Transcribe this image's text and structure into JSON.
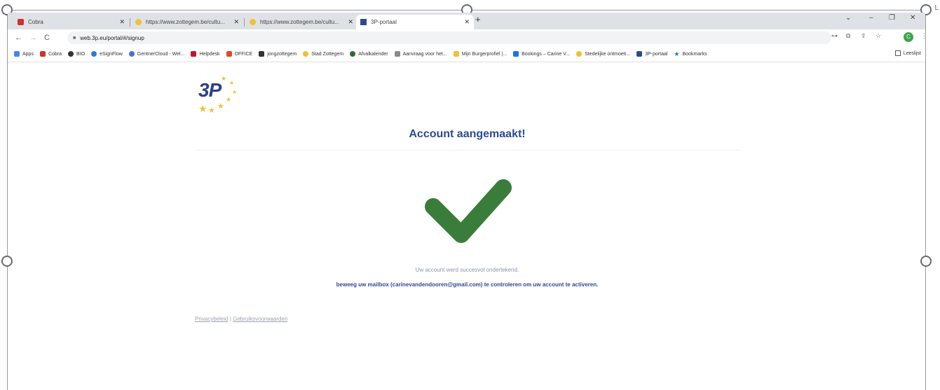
{
  "tabs": [
    {
      "label": "Cobra",
      "favicon_color": "#d0312d"
    },
    {
      "label": "https://www.zottegem.be/cultu...",
      "favicon_color": "#f2c12e"
    },
    {
      "label": "https://www.zottegem.be/cultu...",
      "favicon_color": "#f2c12e"
    },
    {
      "label": "3P-portaal",
      "favicon_color": "#2e4a8f"
    }
  ],
  "new_tab_symbol": "+",
  "window_controls": {
    "collapse": "⌄",
    "minimize": "–",
    "restore": "❐",
    "close": "✕"
  },
  "omnibox": {
    "url": "web.3p.eu/portal/#/signup"
  },
  "avatar_letter": "C",
  "bookmarks": [
    {
      "label": "Apps",
      "color": "#4285f4"
    },
    {
      "label": "Cobra",
      "color": "#d0312d"
    },
    {
      "label": "BIO",
      "color": "#333333"
    },
    {
      "label": "eSignFlow",
      "color": "#2b7bd6"
    },
    {
      "label": "GentnerCloud - Wel...",
      "color": "#4a6fd6"
    },
    {
      "label": "Helpdesk",
      "color": "#c4122f"
    },
    {
      "label": "OFFICE",
      "color": "#e04b1c"
    },
    {
      "label": "jongzottegem",
      "color": "#333333"
    },
    {
      "label": "Stad Zottegem",
      "color": "#f2c12e"
    },
    {
      "label": "Afvalkalender",
      "color": "#2e6b2e"
    },
    {
      "label": "Aanvraag voor het...",
      "color": "#888888"
    },
    {
      "label": "Mijn Burgerprofiel |...",
      "color": "#f2c12e"
    },
    {
      "label": "Bookings – Carine V...",
      "color": "#1a73e8"
    },
    {
      "label": "Stedelijke ontmoeti...",
      "color": "#f2c12e"
    },
    {
      "label": "3P-portaal",
      "color": "#2e4a8f"
    },
    {
      "label": "Bookmarks",
      "color": "#1a73e8"
    }
  ],
  "reading_list": "Leeslijst",
  "page": {
    "logo_text": "3P",
    "title": "Account aangemaakt!",
    "message_primary": "Uw account werd succesvol ondertekend.",
    "message_secondary": "beweeg uw mailbox (carinevandendooren@gmail.com) te controleren om uw account te activeren.",
    "footer_privacy": "Privacybeleid",
    "footer_separator": "|",
    "footer_terms": "Gebruiksvoorwaarden"
  },
  "colors": {
    "check": "#3a7d3a",
    "title": "#2e4a8f",
    "star": "#f2c12e"
  },
  "corner_mark": "L"
}
